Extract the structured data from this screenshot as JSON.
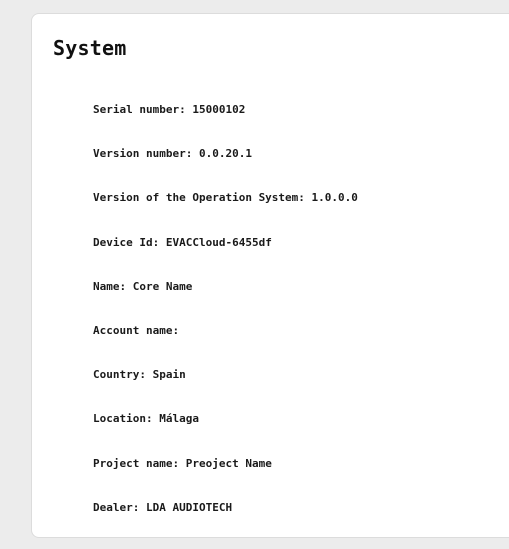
{
  "panel": {
    "title": "System",
    "items": [
      {
        "label": "Serial number:",
        "value": "15000102"
      },
      {
        "label": "Version number:",
        "value": "0.0.20.1"
      },
      {
        "label": "Version of the Operation System:",
        "value": "1.0.0.0"
      },
      {
        "label": "Device Id:",
        "value": "EVACCloud-6455df"
      },
      {
        "label": "Name:",
        "value": "Core Name"
      },
      {
        "label": "Account name:",
        "value": ""
      },
      {
        "label": "Country:",
        "value": "Spain"
      },
      {
        "label": "Location:",
        "value": "Málaga"
      },
      {
        "label": "Project name:",
        "value": "Preoject Name"
      },
      {
        "label": "Dealer:",
        "value": "LDA AUDIOTECH"
      }
    ]
  }
}
